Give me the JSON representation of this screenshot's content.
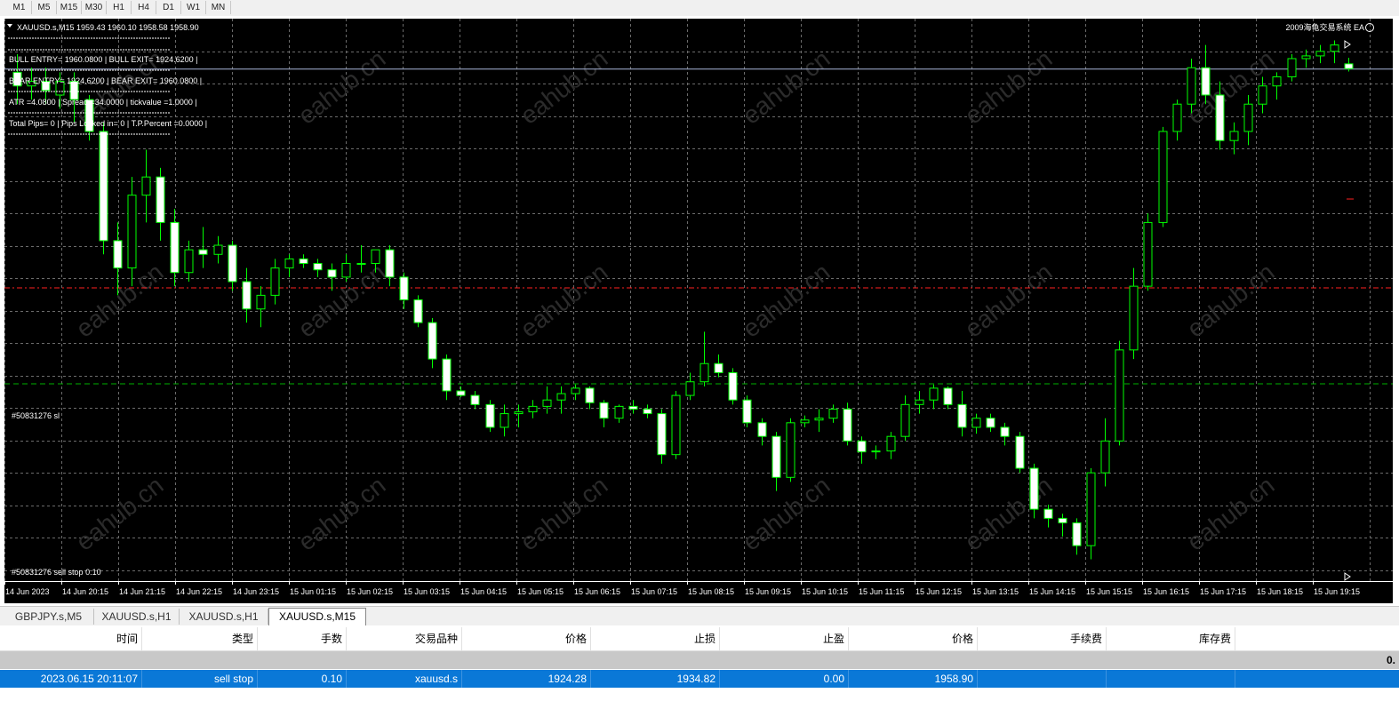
{
  "timeframes": [
    "M1",
    "M5",
    "M15",
    "M30",
    "H1",
    "H4",
    "D1",
    "W1",
    "MN"
  ],
  "chart": {
    "header": "XAUUSD.s,M15  1959.43 1960.10 1958.58 1958.90",
    "ea_label": "2009海龟交易系统 EA",
    "info_lines": [
      "BULL ENTRY= 1960.0800 | BULL EXIT= 1924.6200 |",
      "BEAR ENTRY= 1924.6200 | BEAR EXIT= 1960.0800 |",
      "ATR =4.0800 | Spread =34.0000 | tickvalue =1.0000 |",
      "Total Pips= 0 | Pips Locked in= 0 | T.P.Percent =0.0000 |"
    ],
    "order_label_1": "#50831276 sl",
    "order_label_2": "#50831276 sell stop 0.10",
    "watermark": "eahub.cn",
    "time_labels": [
      "14 Jun 2023",
      "14 Jun 20:15",
      "14 Jun 21:15",
      "14 Jun 22:15",
      "14 Jun 23:15",
      "15 Jun 01:15",
      "15 Jun 02:15",
      "15 Jun 03:15",
      "15 Jun 04:15",
      "15 Jun 05:15",
      "15 Jun 06:15",
      "15 Jun 07:15",
      "15 Jun 08:15",
      "15 Jun 09:15",
      "15 Jun 10:15",
      "15 Jun 11:15",
      "15 Jun 12:15",
      "15 Jun 13:15",
      "15 Jun 14:15",
      "15 Jun 15:15",
      "15 Jun 16:15",
      "15 Jun 17:15",
      "15 Jun 18:15",
      "15 Jun 19:15"
    ],
    "colors": {
      "background": "#000000",
      "grid": "#6b6b6b",
      "candle": "#00ff00",
      "bull_body": "#000000",
      "bear_body": "#ffffff",
      "text": "#ffffff",
      "sl_line": "#ff2020",
      "order_line": "#00b000",
      "bid_line": "#a8b4d8"
    }
  },
  "chart_data": {
    "type": "candlestick",
    "candles": [
      [
        1958.5,
        1960.5,
        1955.0,
        1957.0
      ],
      [
        1957.0,
        1959.0,
        1955.5,
        1957.5
      ],
      [
        1957.5,
        1959.0,
        1955.0,
        1956.5
      ],
      [
        1956.0,
        1958.5,
        1954.5,
        1957.5
      ],
      [
        1957.5,
        1958.5,
        1953.0,
        1955.5
      ],
      [
        1955.5,
        1956.0,
        1951.0,
        1952.0
      ],
      [
        1952.0,
        1953.0,
        1938.5,
        1940.0
      ],
      [
        1940.0,
        1942.0,
        1934.0,
        1937.0
      ],
      [
        1937.0,
        1947.0,
        1935.0,
        1945.0
      ],
      [
        1945.0,
        1950.0,
        1942.0,
        1947.0
      ],
      [
        1947.0,
        1948.0,
        1940.0,
        1942.0
      ],
      [
        1942.0,
        1943.5,
        1935.0,
        1936.5
      ],
      [
        1936.5,
        1940.0,
        1935.5,
        1939.0
      ],
      [
        1939.0,
        1941.5,
        1937.0,
        1938.5
      ],
      [
        1938.5,
        1940.5,
        1937.5,
        1939.5
      ],
      [
        1939.5,
        1940.0,
        1934.5,
        1935.5
      ],
      [
        1935.5,
        1937.0,
        1931.0,
        1932.5
      ],
      [
        1932.5,
        1935.0,
        1930.5,
        1934.0
      ],
      [
        1934.0,
        1938.0,
        1933.0,
        1937.0
      ],
      [
        1937.0,
        1938.5,
        1936.0,
        1938.0
      ],
      [
        1938.0,
        1938.5,
        1937.0,
        1937.5
      ],
      [
        1937.5,
        1938.0,
        1936.0,
        1936.8
      ],
      [
        1936.8,
        1937.5,
        1934.5,
        1936.0
      ],
      [
        1936.0,
        1938.5,
        1935.5,
        1937.5
      ],
      [
        1937.5,
        1939.5,
        1936.5,
        1937.5
      ],
      [
        1937.5,
        1939.0,
        1936.5,
        1939.0
      ],
      [
        1939.0,
        1939.5,
        1935.0,
        1936.0
      ],
      [
        1936.0,
        1936.5,
        1932.5,
        1933.5
      ],
      [
        1933.5,
        1934.0,
        1930.5,
        1931.0
      ],
      [
        1931.0,
        1931.5,
        1926.0,
        1927.0
      ],
      [
        1927.0,
        1927.5,
        1922.5,
        1923.5
      ],
      [
        1923.5,
        1924.0,
        1922.8,
        1923.0
      ],
      [
        1923.0,
        1923.5,
        1921.5,
        1922.0
      ],
      [
        1922.0,
        1922.5,
        1919.0,
        1919.5
      ],
      [
        1919.5,
        1922.0,
        1918.5,
        1921.0
      ],
      [
        1921.0,
        1922.0,
        1919.5,
        1921.2
      ],
      [
        1921.2,
        1922.5,
        1920.5,
        1921.8
      ],
      [
        1921.8,
        1924.0,
        1921.0,
        1922.5
      ],
      [
        1922.5,
        1924.0,
        1921.0,
        1923.2
      ],
      [
        1923.2,
        1924.2,
        1922.5,
        1923.8
      ],
      [
        1923.8,
        1924.0,
        1921.5,
        1922.2
      ],
      [
        1922.2,
        1922.5,
        1919.5,
        1920.5
      ],
      [
        1920.5,
        1922.0,
        1920.0,
        1921.8
      ],
      [
        1921.8,
        1922.5,
        1921.0,
        1921.5
      ],
      [
        1921.5,
        1922.0,
        1920.5,
        1921.0
      ],
      [
        1921.0,
        1921.5,
        1915.5,
        1916.5
      ],
      [
        1916.5,
        1923.5,
        1916.0,
        1923.0
      ],
      [
        1923.0,
        1925.5,
        1922.5,
        1924.5
      ],
      [
        1924.5,
        1930.0,
        1924.0,
        1926.5
      ],
      [
        1926.5,
        1927.5,
        1925.0,
        1925.5
      ],
      [
        1925.5,
        1926.0,
        1922.0,
        1922.5
      ],
      [
        1922.5,
        1923.0,
        1919.5,
        1920.0
      ],
      [
        1920.0,
        1920.5,
        1917.5,
        1918.5
      ],
      [
        1918.5,
        1919.0,
        1912.5,
        1914.0
      ],
      [
        1914.0,
        1920.5,
        1913.5,
        1920.0
      ],
      [
        1920.0,
        1920.8,
        1919.5,
        1920.3
      ],
      [
        1920.3,
        1921.5,
        1919.0,
        1920.5
      ],
      [
        1920.5,
        1922.0,
        1920.0,
        1921.5
      ],
      [
        1921.5,
        1922.2,
        1917.5,
        1918.0
      ],
      [
        1918.0,
        1918.5,
        1915.5,
        1916.8
      ],
      [
        1916.8,
        1917.5,
        1916.0,
        1916.9
      ],
      [
        1916.9,
        1919.0,
        1916.0,
        1918.5
      ],
      [
        1918.5,
        1923.0,
        1918.0,
        1922.0
      ],
      [
        1922.0,
        1923.5,
        1921.0,
        1922.5
      ],
      [
        1922.5,
        1924.2,
        1921.5,
        1923.8
      ],
      [
        1923.8,
        1924.0,
        1921.5,
        1922.0
      ],
      [
        1922.0,
        1923.5,
        1918.5,
        1919.5
      ],
      [
        1919.5,
        1921.0,
        1918.8,
        1920.5
      ],
      [
        1920.5,
        1921.0,
        1919.0,
        1919.5
      ],
      [
        1919.5,
        1920.0,
        1917.5,
        1918.5
      ],
      [
        1918.5,
        1919.0,
        1914.5,
        1915.0
      ],
      [
        1915.0,
        1915.5,
        1909.5,
        1910.5
      ],
      [
        1910.5,
        1911.0,
        1908.5,
        1909.5
      ],
      [
        1909.5,
        1910.0,
        1907.5,
        1909.0
      ],
      [
        1909.0,
        1909.5,
        1905.5,
        1906.5
      ],
      [
        1906.5,
        1915.0,
        1905.0,
        1914.5
      ],
      [
        1914.5,
        1920.5,
        1913.0,
        1918.0
      ],
      [
        1918.0,
        1929.0,
        1917.5,
        1928.0
      ],
      [
        1928.0,
        1937.0,
        1927.0,
        1935.0
      ],
      [
        1935.0,
        1943.0,
        1934.5,
        1942.0
      ],
      [
        1942.0,
        1952.5,
        1941.5,
        1952.0
      ],
      [
        1952.0,
        1955.5,
        1951.0,
        1955.0
      ],
      [
        1955.0,
        1960.0,
        1954.0,
        1959.0
      ],
      [
        1959.0,
        1961.5,
        1955.0,
        1956.0
      ],
      [
        1956.0,
        1957.5,
        1950.0,
        1951.0
      ],
      [
        1951.0,
        1953.0,
        1949.5,
        1952.0
      ],
      [
        1952.0,
        1956.0,
        1950.5,
        1955.0
      ],
      [
        1955.0,
        1958.0,
        1954.0,
        1957.0
      ],
      [
        1957.0,
        1958.5,
        1955.5,
        1958.0
      ],
      [
        1958.0,
        1960.5,
        1957.5,
        1960.0
      ],
      [
        1960.0,
        1961.0,
        1959.0,
        1960.3
      ],
      [
        1960.3,
        1961.5,
        1959.5,
        1960.8
      ],
      [
        1960.8,
        1962.0,
        1959.5,
        1961.5
      ],
      [
        1959.43,
        1960.1,
        1958.58,
        1958.9
      ]
    ],
    "bid": 1958.9,
    "sl_price": 1934.82,
    "order_price": 1924.28
  },
  "chart_tabs": [
    {
      "label": "GBPJPY.s,M5"
    },
    {
      "label": "XAUUSD.s,H1"
    },
    {
      "label": "XAUUSD.s,H1"
    },
    {
      "label": "XAUUSD.s,M15"
    }
  ],
  "orders": {
    "headers": [
      "时间",
      "类型",
      "手数",
      "交易品种",
      "价格",
      "止损",
      "止盈",
      "价格",
      "手续费",
      "库存费"
    ],
    "summary_value": "0.",
    "rows": [
      {
        "time": "2023.06.15 20:11:07",
        "type": "sell stop",
        "lots": "0.10",
        "symbol": "xauusd.s",
        "price": "1924.28",
        "sl": "1934.82",
        "tp": "0.00",
        "cur_price": "1958.90",
        "commission": "",
        "swap": ""
      }
    ]
  }
}
